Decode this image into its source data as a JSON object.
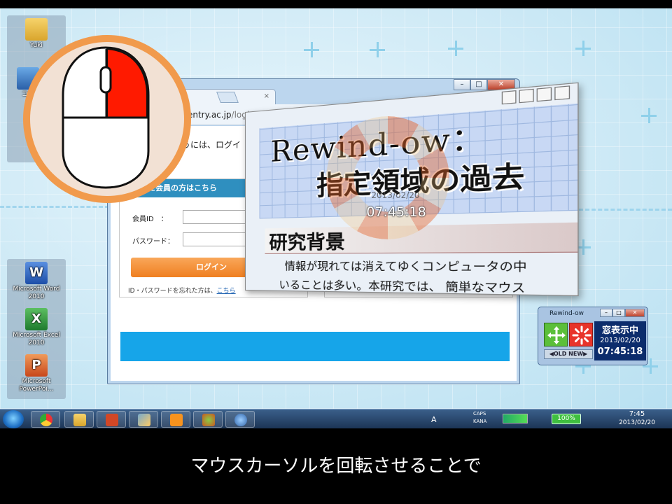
{
  "desktop": {
    "icons": [
      {
        "label": "Yuki"
      },
      {
        "label": "コン"
      },
      {
        "label": "Microsoft Word 2010"
      },
      {
        "label": "Microsoft Excel 2010"
      },
      {
        "label": "Microsoft PowerPoi..."
      }
    ]
  },
  "browser": {
    "url_host": "v.entry.ac.jp",
    "url_path": "/login/",
    "tab_close": "×",
    "win_min": "–",
    "win_max": "□",
    "win_close": "✕",
    "login_heading": "行うには、ログイ",
    "member_bar": "に会員の方はこちら",
    "member_id_label": "会員ID　：",
    "password_label": "パスワード：",
    "login_button": "ログイン",
    "forgot_text": "ID・パスワードを忘れた方は、",
    "forgot_link": "こちら"
  },
  "captured": {
    "title_line1": "Rewind-ow：",
    "title_line2": "指定領域の過去",
    "section_title": "研究背景",
    "body_line1": "情報が現れては消えてゆくコンピュータの中",
    "body_line2": "いることは多い。本研究では、 簡単なマウス"
  },
  "dial": {
    "date": "2013/02/20",
    "time": "07:45:18"
  },
  "widget": {
    "title": "Rewind-ow",
    "status": "窓表示中",
    "date": "2013/02/20",
    "time": "07:45:18",
    "old_new": "◀OLD NEW▶",
    "min": "–",
    "max": "□",
    "close": "✕"
  },
  "taskbar": {
    "ime": "A",
    "caps": "CAPS",
    "kana": "KANA",
    "battery": "100%",
    "clock_time": "7:45",
    "clock_date": "2013/02/20",
    "apps": [
      "chrome",
      "explorer",
      "powerpoint",
      "paint",
      "illustrator",
      "app",
      "rewind-ow"
    ]
  },
  "subtitle": "マウスカーソルを回転させることで",
  "colors": {
    "mouse_ring": "#f19a4c",
    "mouse_highlight": "#ff1a00",
    "login_button": "#f08a2e",
    "member_bar": "#2f8fbf",
    "blue_band": "#16a5e9",
    "widget_move": "#5bbf3a",
    "widget_rotate": "#e8342a"
  }
}
